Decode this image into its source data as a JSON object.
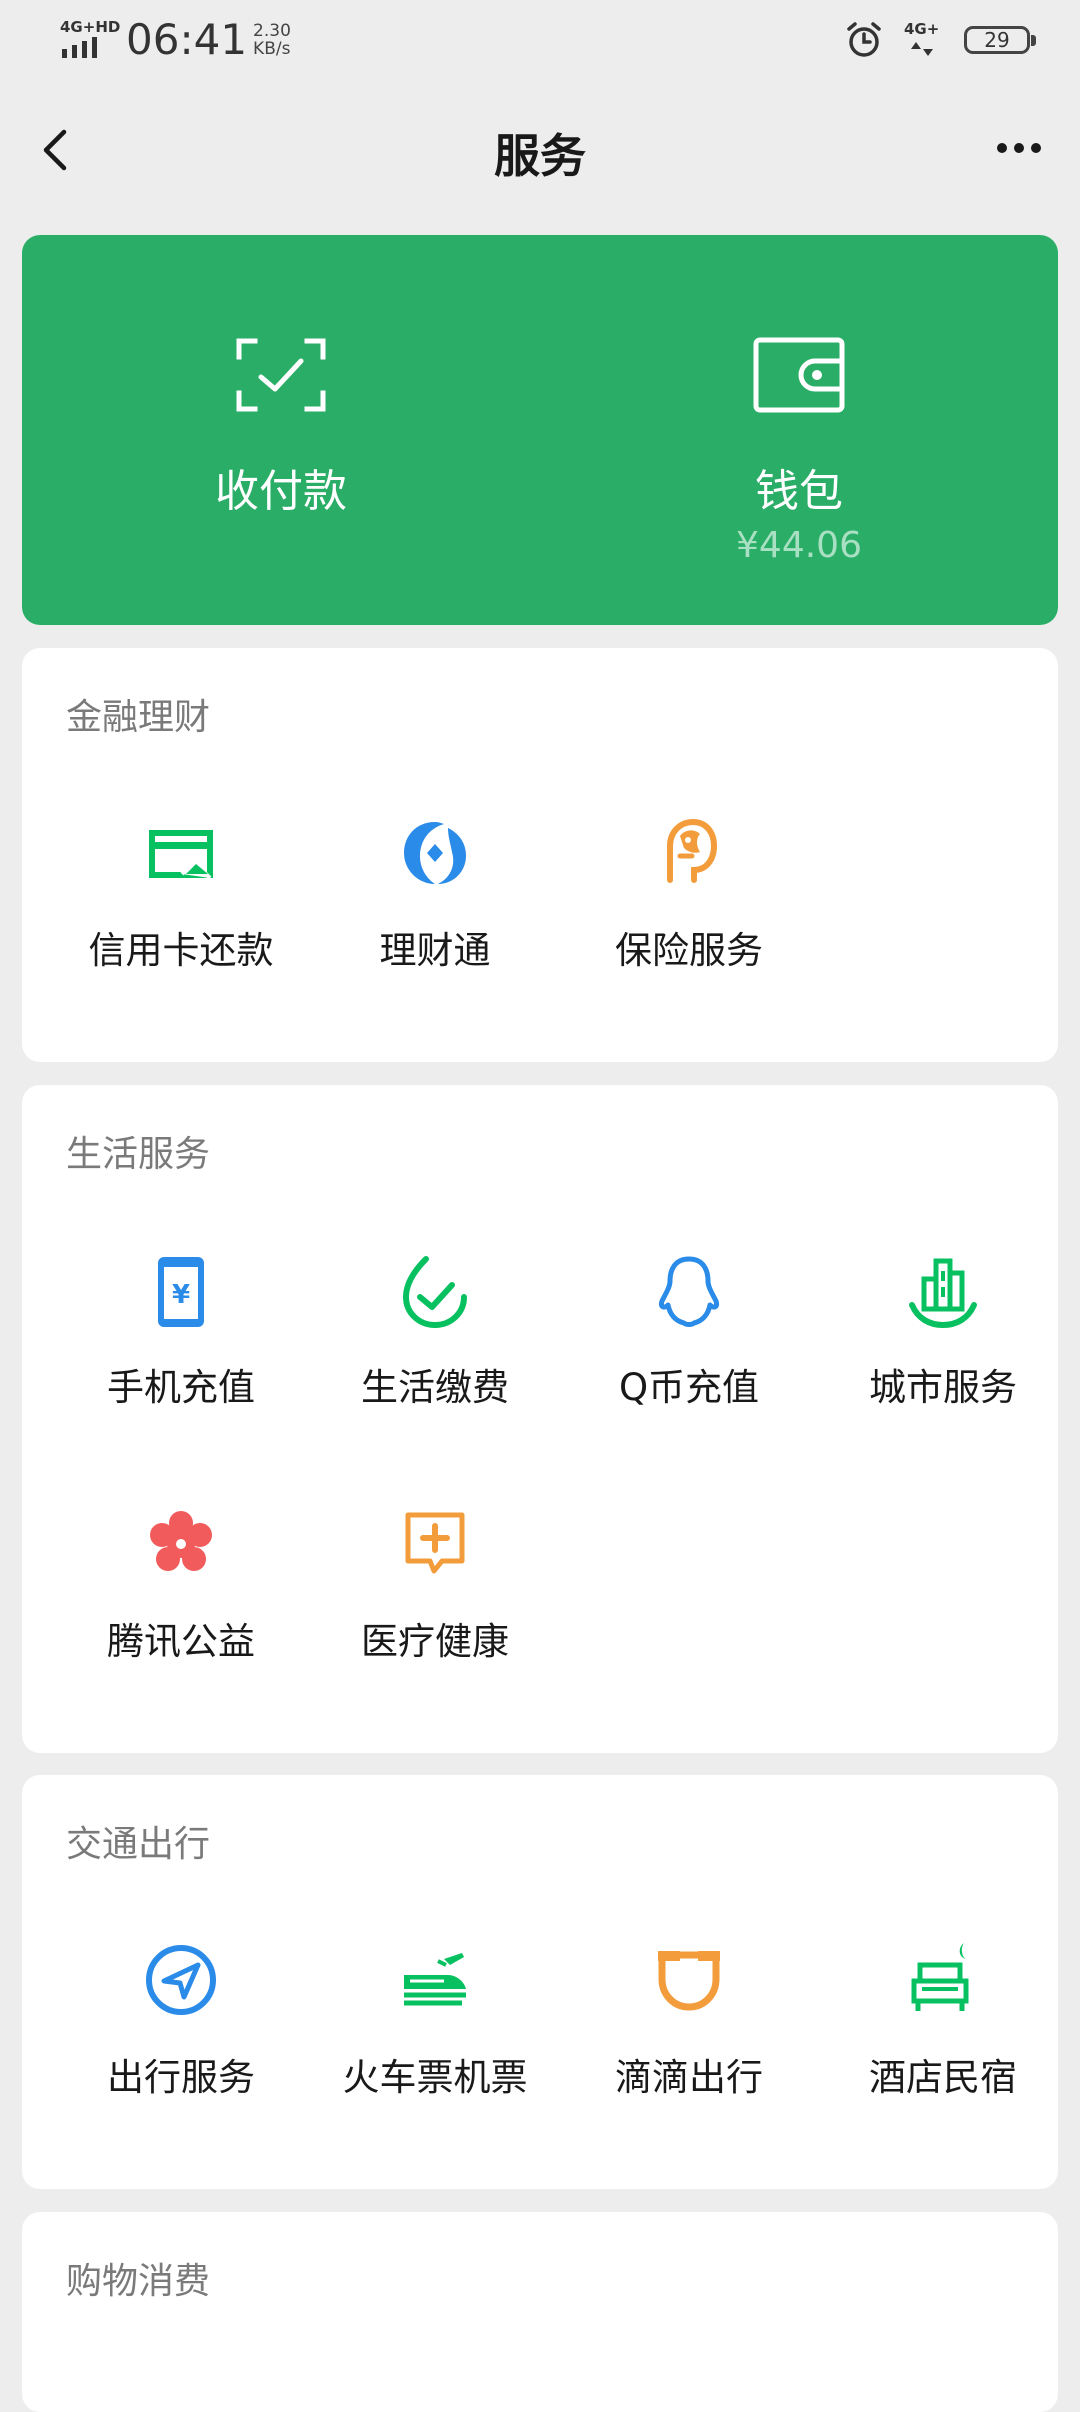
{
  "status_bar": {
    "network_tag": "4G+HD",
    "time": "06:41",
    "speed_value": "2.30",
    "speed_unit": "KB/s",
    "network_tag_right": "4G+",
    "battery": "29"
  },
  "nav": {
    "title": "服务",
    "back_icon": "chevron-left-icon",
    "more_icon": "more-dots-icon"
  },
  "pay_card": {
    "color": "#2aae67",
    "receive_pay": {
      "label": "收付款",
      "icon": "scan-check-icon"
    },
    "wallet": {
      "label": "钱包",
      "balance": "¥44.06",
      "icon": "wallet-icon"
    }
  },
  "sections": {
    "finance": {
      "title": "金融理财",
      "items": [
        {
          "label": "信用卡还款",
          "icon": "credit-card-icon"
        },
        {
          "label": "理财通",
          "icon": "wealth-icon"
        },
        {
          "label": "保险服务",
          "icon": "insurance-icon"
        }
      ]
    },
    "life": {
      "title": "生活服务",
      "items": [
        {
          "label": "手机充值",
          "icon": "phone-recharge-icon"
        },
        {
          "label": "生活缴费",
          "icon": "utility-check-icon"
        },
        {
          "label": "Q币充值",
          "icon": "qq-penguin-icon"
        },
        {
          "label": "城市服务",
          "icon": "city-buildings-icon"
        },
        {
          "label": "腾讯公益",
          "icon": "charity-flower-icon"
        },
        {
          "label": "医疗健康",
          "icon": "medical-cross-icon"
        }
      ]
    },
    "transport": {
      "title": "交通出行",
      "items": [
        {
          "label": "出行服务",
          "icon": "navigation-arrow-icon"
        },
        {
          "label": "火车票机票",
          "icon": "train-plane-icon"
        },
        {
          "label": "滴滴出行",
          "icon": "didi-icon"
        },
        {
          "label": "酒店民宿",
          "icon": "hotel-bed-icon"
        }
      ]
    },
    "shopping": {
      "title": "购物消费"
    }
  },
  "colors": {
    "green": "#07c160",
    "blue": "#2a8be8",
    "orange": "#f39c3b",
    "red": "#f15b5b"
  }
}
